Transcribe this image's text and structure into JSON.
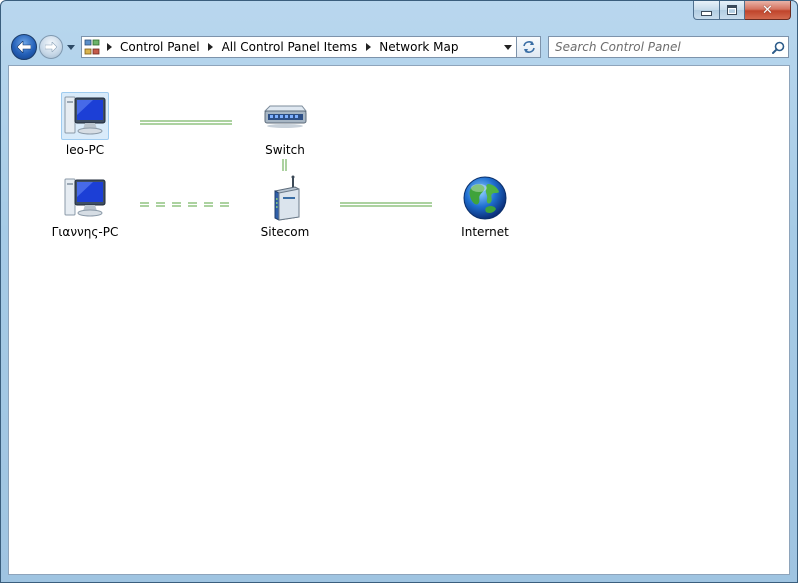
{
  "window": {
    "min_glyph": "minimize",
    "max_glyph": "maximize",
    "close_glyph": "✕"
  },
  "address": {
    "breadcrumbs": [
      "Control Panel",
      "All Control Panel Items",
      "Network Map"
    ]
  },
  "search": {
    "placeholder": "Search Control Panel"
  },
  "network_map": {
    "nodes": {
      "leo_pc": {
        "label": "leo-PC",
        "icon": "computer-icon"
      },
      "switch": {
        "label": "Switch",
        "icon": "switch-icon"
      },
      "giannis_pc": {
        "label": "Γιαννης-PC",
        "icon": "computer-icon"
      },
      "sitecom": {
        "label": "Sitecom",
        "icon": "router-icon"
      },
      "internet": {
        "label": "Internet",
        "icon": "globe-icon"
      }
    },
    "links": [
      {
        "from": "leo-PC",
        "to": "Switch",
        "style": "solid"
      },
      {
        "from": "Switch",
        "to": "Sitecom",
        "style": "solid"
      },
      {
        "from": "Γιαννης-PC",
        "to": "Sitecom",
        "style": "dashed"
      },
      {
        "from": "Sitecom",
        "to": "Internet",
        "style": "solid"
      }
    ],
    "link_color": "#5aa640"
  },
  "colors": {
    "frame": "#a6cbe6",
    "close_button": "#c9523a",
    "selection": "#d9ebfa"
  }
}
